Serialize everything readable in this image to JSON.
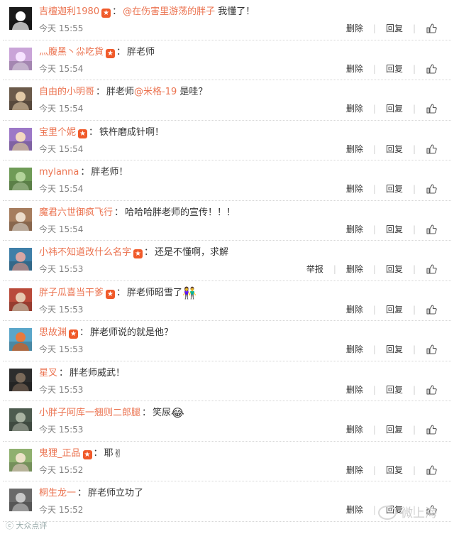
{
  "comments": [
    {
      "user": "吉檀迦利1980",
      "star": true,
      "mention": "@在伤害里游荡的胖子",
      "text": "我懂了！",
      "emoji": "",
      "time": "今天 15:55",
      "report": false,
      "av_bg": "#1b1b1b",
      "av_fg": "#ffffff"
    },
    {
      "user": "灬腹黑丶尛吃貨",
      "star": true,
      "mention": "",
      "text": "胖老师",
      "emoji": "",
      "time": "今天 15:54",
      "report": false,
      "av_bg": "#c9a4d8",
      "av_fg": "#f6e3ff"
    },
    {
      "user": "自由的小明哥",
      "star": false,
      "mention": "",
      "text": "胖老师",
      "mention2": "@米格-19",
      "text2": "是哇？",
      "emoji": "",
      "time": "今天 15:54",
      "report": false,
      "av_bg": "#6b5a4a",
      "av_fg": "#e2c9a6"
    },
    {
      "user": "宝里个妮",
      "star": true,
      "mention": "",
      "text": "铁杵磨成针啊！",
      "emoji": "",
      "time": "今天 15:54",
      "report": false,
      "av_bg": "#9c78c7",
      "av_fg": "#f4d9c0"
    },
    {
      "user": "mylanna",
      "star": false,
      "mention": "",
      "text": "胖老师！",
      "emoji": "",
      "time": "今天 15:54",
      "report": false,
      "av_bg": "#6f9b57",
      "av_fg": "#b3d49a"
    },
    {
      "user": "魔君六世御疯飞行",
      "star": false,
      "mention": "",
      "text": "哈哈哈胖老师的宣传！！！",
      "emoji": "",
      "time": "今天 15:54",
      "report": false,
      "av_bg": "#a67d5e",
      "av_fg": "#ecdccb"
    },
    {
      "user": "小祎不知道改什么名字",
      "star": true,
      "mention": "",
      "text": "还是不懂啊，求解",
      "emoji": "",
      "time": "今天 15:53",
      "report": true,
      "av_bg": "#3f7fa8",
      "av_fg": "#d9a6a3"
    },
    {
      "user": "胖子瓜喜当干爹",
      "star": true,
      "mention": "",
      "text": "胖老师昭雪了",
      "emoji": "👫",
      "time": "今天 15:53",
      "report": false,
      "av_bg": "#b94a3a",
      "av_fg": "#e6c9b0"
    },
    {
      "user": "思故渊",
      "star": true,
      "mention": "",
      "text": "胖老师说的就是他？",
      "emoji": "",
      "time": "今天 15:53",
      "report": false,
      "av_bg": "#5aa6c9",
      "av_fg": "#e87a3d"
    },
    {
      "user": "星叉",
      "star": false,
      "mention": "",
      "text": "胖老师威武！",
      "emoji": "",
      "time": "今天 15:53",
      "report": false,
      "av_bg": "#2d2d2d",
      "av_fg": "#7b6a5a"
    },
    {
      "user": "小胖子阿库一翘则二郎腿",
      "star": false,
      "mention": "",
      "text": "笑尿",
      "emoji": "😂",
      "time": "今天 15:53",
      "report": false,
      "av_bg": "#4d5b4f",
      "av_fg": "#a9b3a2"
    },
    {
      "user": "鬼狸_正品",
      "star": true,
      "mention": "",
      "text": "耶",
      "emoji": "✌",
      "time": "今天 15:52",
      "report": false,
      "av_bg": "#8fb06f",
      "av_fg": "#ece2c8"
    },
    {
      "user": "桐生龙一",
      "star": false,
      "mention": "",
      "text": "胖老师立功了",
      "emoji": "",
      "time": "今天 15:52",
      "report": false,
      "av_bg": "#6a6a6a",
      "av_fg": "#c8c8c8"
    }
  ],
  "labels": {
    "report": "举报",
    "delete": "删除",
    "reply": "回复",
    "star_glyph": "★",
    "colon": "："
  },
  "watermark": {
    "left": "ⓒ 大众点评",
    "right": "微上海"
  }
}
